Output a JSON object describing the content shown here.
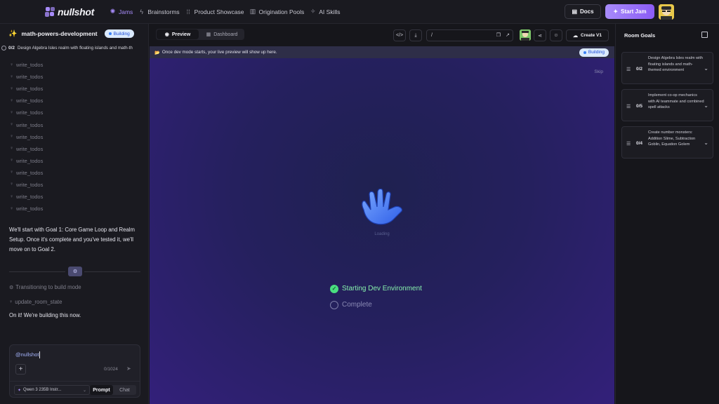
{
  "header": {
    "logo_text": "nullshot",
    "nav": [
      {
        "label": "Jams",
        "icon": "gamepad-icon",
        "active": true
      },
      {
        "label": "Brainstorms",
        "icon": "lightning-icon",
        "active": false
      },
      {
        "label": "Product Showcase",
        "icon": "grid-icon",
        "active": false
      },
      {
        "label": "Origination Pools",
        "icon": "bar-chart-icon",
        "active": false
      },
      {
        "label": "AI Skills",
        "icon": "sparkles-icon",
        "active": false
      }
    ],
    "docs_label": "Docs",
    "start_jam_label": "Start Jam"
  },
  "room": {
    "name": "math-powers-development",
    "status": "Building",
    "goal_count": "0/2",
    "goal_text": "Design Algebra Isles realm with floating islands and math-th"
  },
  "chat": {
    "todos": [
      "write_todos",
      "write_todos",
      "write_todos",
      "write_todos",
      "write_todos",
      "write_todos",
      "write_todos",
      "write_todos",
      "write_todos",
      "write_todos",
      "write_todos",
      "write_todos",
      "write_todos"
    ],
    "message1": "We'll start with Goal 1: Core Game Loop and Realm Setup. Once it's complete and you've tested it, we'll move on to Goal 2.",
    "transition": "Transitioning to build mode",
    "update_tool": "update_room_state",
    "message2": "On it! We're building this now.",
    "input_value": "@nullshot",
    "char_count": "0/1024",
    "model": "Qwen 3 235B Instr...",
    "mode_prompt": "Prompt",
    "mode_chat": "Chat"
  },
  "toolbar": {
    "preview_label": "Preview",
    "dashboard_label": "Dashboard",
    "url": "/",
    "create_label": "Create V1"
  },
  "preview": {
    "notice": "Once dev mode starts, your live preview will show up here.",
    "status": "Building",
    "skip_label": "Skip",
    "loading_label": "Loading",
    "steps": [
      {
        "label": "Starting Dev Environment",
        "done": true
      },
      {
        "label": "Complete",
        "done": false
      }
    ]
  },
  "goals": {
    "title": "Room Goals",
    "items": [
      {
        "count": "0/2",
        "text": "Design Algebra Isles realm with floating islands and math-themed environment"
      },
      {
        "count": "0/5",
        "text": "Implement co-op mechanics with AI teammate and combined spell attacks"
      },
      {
        "count": "0/4",
        "text": "Create number monsters: Addition Slime, Subtraction Goblin, Equation Golem"
      }
    ]
  },
  "colors": {
    "accent": "#a78bfa",
    "success": "#4ade80",
    "badge_bg": "#dbeafe"
  }
}
